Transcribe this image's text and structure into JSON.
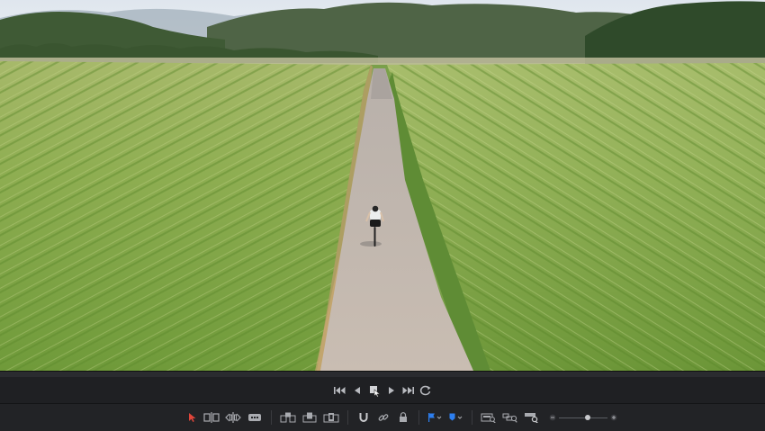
{
  "viewer": {
    "scene": "aerial-cornfield-road-cyclist"
  },
  "transport": {
    "buttons": [
      {
        "name": "go-to-start-icon"
      },
      {
        "name": "play-reverse-icon"
      },
      {
        "name": "stop-icon"
      },
      {
        "name": "play-icon"
      },
      {
        "name": "go-to-end-icon"
      },
      {
        "name": "loop-icon"
      }
    ]
  },
  "toolbar": {
    "tools": [
      {
        "name": "selection-mode-icon",
        "active": true
      },
      {
        "name": "trim-edit-mode-icon"
      },
      {
        "name": "dynamic-trim-mode-icon"
      },
      {
        "name": "blade-edit-mode-icon"
      },
      {
        "name": "insert-clip-icon"
      },
      {
        "name": "overwrite-clip-icon"
      },
      {
        "name": "replace-clip-icon"
      },
      {
        "name": "snapping-icon"
      },
      {
        "name": "linked-selection-icon"
      },
      {
        "name": "position-lock-icon"
      },
      {
        "name": "flag-icon"
      },
      {
        "name": "marker-icon"
      },
      {
        "name": "zoom-full-icon"
      },
      {
        "name": "zoom-detail-icon"
      },
      {
        "name": "zoom-custom-icon"
      },
      {
        "name": "zoom-out-icon"
      },
      {
        "name": "zoom-in-icon"
      }
    ],
    "zoom_level": 0.6
  },
  "colors": {
    "accent_red": "#e0453a",
    "accent_blue": "#2d7ff0",
    "icon_gray": "#a9abb0",
    "background": "#222326"
  }
}
